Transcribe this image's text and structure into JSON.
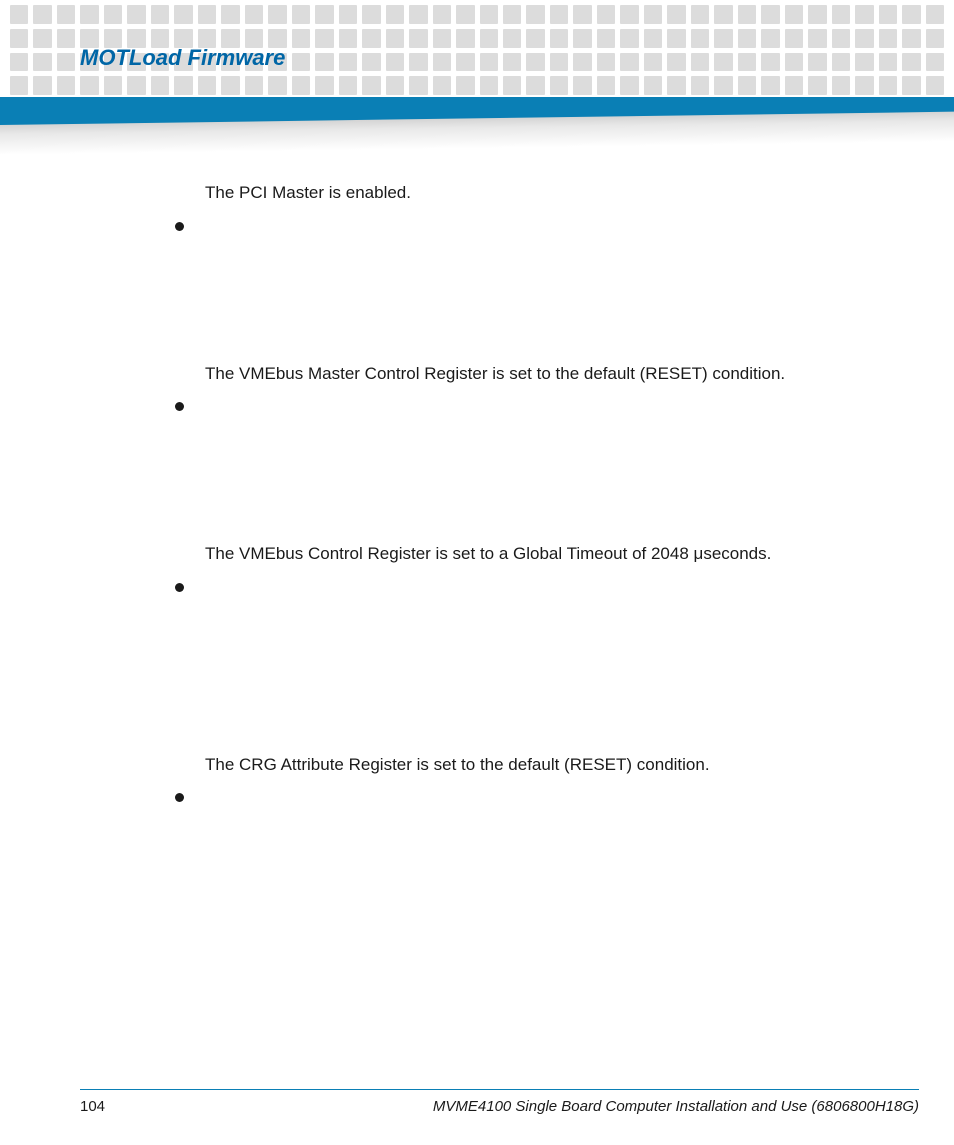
{
  "header": {
    "title": "MOTLoad Firmware"
  },
  "content": {
    "items": [
      "The PCI Master is enabled.",
      "The VMEbus Master Control Register is set to the default (RESET) condition.",
      "The VMEbus Control Register is set to a Global Timeout of 2048 μseconds.",
      "The CRG Attribute Register is set to the default (RESET) condition."
    ]
  },
  "footer": {
    "page_number": "104",
    "doc_title": "MVME4100 Single Board Computer Installation and Use (6806800H18G)"
  }
}
